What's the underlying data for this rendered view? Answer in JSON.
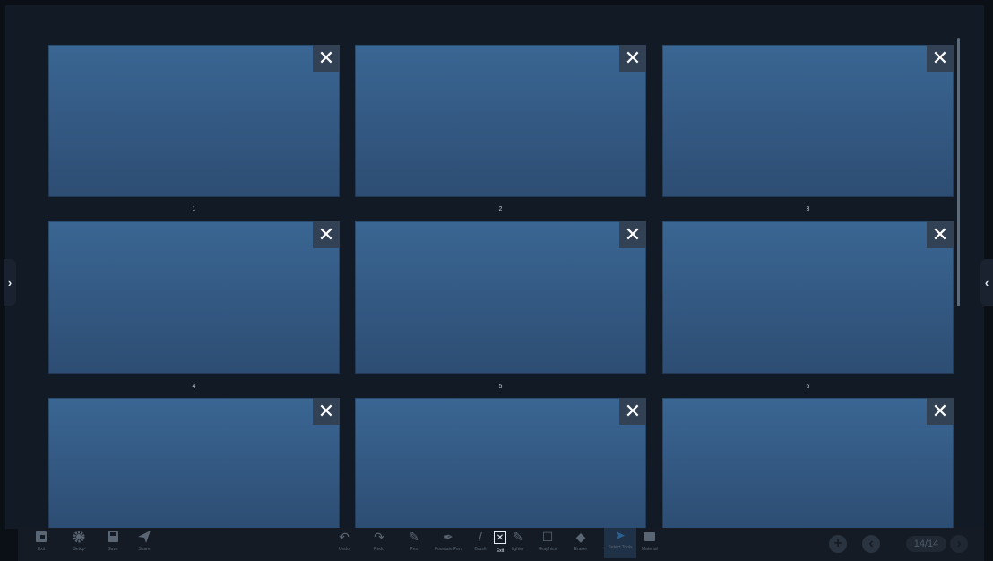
{
  "thumbnails": [
    {
      "number": "1",
      "close_label": "✕"
    },
    {
      "number": "2",
      "close_label": "✕"
    },
    {
      "number": "3",
      "close_label": "✕"
    },
    {
      "number": "4",
      "close_label": "✕"
    },
    {
      "number": "5",
      "close_label": "✕"
    },
    {
      "number": "6",
      "close_label": "✕"
    },
    {
      "close_label": "✕"
    },
    {
      "close_label": "✕"
    },
    {
      "close_label": "✕"
    }
  ],
  "side_handles": {
    "left": "›",
    "right": "‹"
  },
  "toolbar": {
    "left": [
      {
        "label": "Exit",
        "icon": "exit-icon"
      },
      {
        "label": "Setup",
        "icon": "gear-icon"
      },
      {
        "label": "Save",
        "icon": "save-icon"
      },
      {
        "label": "Share",
        "icon": "share-icon"
      }
    ],
    "center": [
      {
        "label": "Undo",
        "icon": "undo-icon"
      },
      {
        "label": "Redo",
        "icon": "redo-icon"
      },
      {
        "label": "Pen",
        "icon": "pen-icon"
      },
      {
        "label": "Fountain Pen",
        "icon": "fountain-pen-icon"
      },
      {
        "label": "Brush",
        "icon": "brush-icon"
      },
      {
        "label": "Exit",
        "icon": "close-icon"
      },
      {
        "label": "lighter",
        "icon": "highlighter-icon"
      },
      {
        "label": "Graphics",
        "icon": "square-icon"
      },
      {
        "label": "Eraser",
        "icon": "eraser-icon"
      },
      {
        "label": "Select Tools",
        "icon": "cursor-icon"
      },
      {
        "label": "Material",
        "icon": "folder-icon"
      }
    ],
    "page_indicator": "14/14",
    "add_page_icon": "plus-circle-icon",
    "prev_page_icon": "arrow-left-circle-icon",
    "next_page_icon": "arrow-right-circle-icon"
  }
}
